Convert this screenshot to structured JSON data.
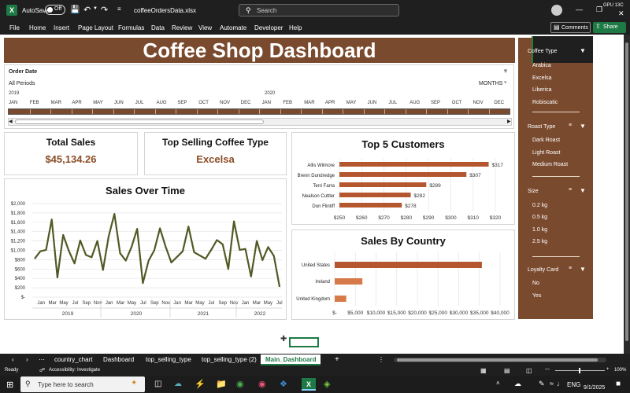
{
  "titlebar": {
    "autosave_label": "AutoSave",
    "autosave_state": "Off",
    "file_name": "coffeeOrdersData.xlsx",
    "search_placeholder": "Search",
    "gpu_label": "GPU 1",
    "gpu_value": "3C"
  },
  "menu": {
    "items": [
      "File",
      "Home",
      "Insert",
      "Page Layout",
      "Formulas",
      "Data",
      "Review",
      "View",
      "Automate",
      "Developer",
      "Help"
    ],
    "comments_label": "Comments",
    "share_label": "Share"
  },
  "dashboard": {
    "title": "Coffee Shop Dashboard",
    "timeline": {
      "caption": "Order Date",
      "range_label": "All Periods",
      "level_label": "MONTHS",
      "years": [
        "2019",
        "2020"
      ],
      "months": [
        "JAN",
        "FEB",
        "MAR",
        "APR",
        "MAY",
        "JUN",
        "JUL",
        "AUG",
        "SEP",
        "OCT",
        "NOV",
        "DEC",
        "JAN",
        "FEB",
        "MAR",
        "APR",
        "MAY",
        "JUN",
        "JUL",
        "AUG",
        "SEP",
        "OCT",
        "NOV",
        "DEC"
      ]
    },
    "total_sales": {
      "title": "Total Sales",
      "value": "$45,134.26"
    },
    "top_type": {
      "title": "Top Selling Coffee Type",
      "value": "Excelsa"
    },
    "colors": {
      "brown": "#7a4a2e",
      "bar": "#b5572e",
      "line": "#4f5a24",
      "orange": "#d77a4a"
    }
  },
  "slicers": {
    "coffee_type": {
      "title": "Coffee Type",
      "items": [
        "Arabica",
        "Excelsa",
        "Liberica",
        "Robiscatic"
      ]
    },
    "roast_type": {
      "title": "Roast Type",
      "items": [
        "Dark Roast",
        "Light Roast",
        "Medium Roast"
      ]
    },
    "size": {
      "title": "Size",
      "items": [
        "0.2 kg",
        "0.5 kg",
        "1.0 kg",
        "2.5 kg"
      ]
    },
    "loyalty": {
      "title": "Loyalty Card",
      "items": [
        "No",
        "Yes"
      ]
    }
  },
  "sheet_tabs": {
    "items": [
      "country_chart",
      "Dashboard",
      "top_selling_type",
      "top_selling_type (2)",
      "Main_Dashboard"
    ],
    "active": "Main_Dashboard"
  },
  "status": {
    "ready": "Ready",
    "accessibility": "Accessibility: Investigate",
    "zoom": "100%"
  },
  "taskbar": {
    "search_placeholder": "Type here to search",
    "lang": "ENG",
    "date": "9/1/2025"
  },
  "chart_data": [
    {
      "type": "bar",
      "title": "Top 5 Customers",
      "orientation": "horizontal",
      "categories": [
        "Allis Wilmore",
        "Brenn Dundredge",
        "Terri Farra",
        "Nealson Cuttler",
        "Don Flintiff"
      ],
      "values": [
        317,
        307,
        289,
        282,
        278
      ],
      "data_labels": [
        "$317",
        "$307",
        "$289",
        "$282",
        "$278"
      ],
      "xlim": [
        250,
        320
      ],
      "x_ticks": [
        "$250",
        "$260",
        "$270",
        "$280",
        "$290",
        "$300",
        "$310",
        "$320"
      ]
    },
    {
      "type": "line",
      "title": "Sales Over Time",
      "y_ticks": [
        "$-",
        "$200",
        "$400",
        "$600",
        "$800",
        "$1,000",
        "$1,200",
        "$1,400",
        "$1,600",
        "$1,800",
        "$2,000"
      ],
      "ylim": [
        0,
        2000
      ],
      "x_month_labels": [
        "Jan",
        "Mar",
        "May",
        "Jul",
        "Sep",
        "Nov",
        "Jan",
        "Mar",
        "May",
        "Jul",
        "Sep",
        "Nov",
        "Jan",
        "Mar",
        "May",
        "Jul",
        "Sep",
        "Nov",
        "Jan",
        "Mar",
        "May",
        "Jul"
      ],
      "x_year_labels": [
        "2019",
        "2020",
        "2021",
        "2022"
      ],
      "values": [
        820,
        980,
        1010,
        1660,
        420,
        1330,
        990,
        720,
        1210,
        900,
        850,
        1200,
        580,
        1300,
        1780,
        940,
        780,
        1070,
        1460,
        300,
        780,
        1000,
        1470,
        1080,
        740,
        860,
        980,
        1510,
        960,
        890,
        820,
        1010,
        1220,
        1130,
        600,
        1620,
        1010,
        1030,
        440,
        1200,
        790,
        1070,
        880,
        220
      ]
    },
    {
      "type": "bar",
      "title": "Sales By Country",
      "orientation": "horizontal",
      "categories": [
        "United States",
        "Ireland",
        "United Kingdom"
      ],
      "values": [
        35600,
        6700,
        2800
      ],
      "xlim": [
        0,
        40000
      ],
      "x_ticks": [
        "$-",
        "$5,000",
        "$10,000",
        "$15,000",
        "$20,000",
        "$25,000",
        "$30,000",
        "$35,000",
        "$40,000"
      ]
    }
  ]
}
